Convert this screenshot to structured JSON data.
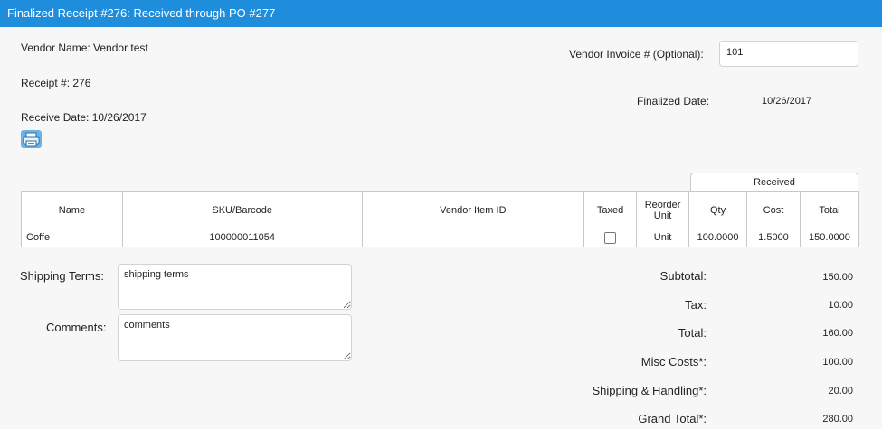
{
  "window": {
    "title": "Finalized Receipt #276: Received through PO #277"
  },
  "info": {
    "vendor_name": "Vendor Name: Vendor test",
    "receipt_no": "Receipt #: 276",
    "receive_date": "Receive Date: 10/26/2017",
    "vendor_invoice_label": "Vendor Invoice # (Optional):",
    "vendor_invoice_value": "101",
    "finalized_date_label": "Finalized Date:",
    "finalized_date_value": "10/26/2017"
  },
  "table": {
    "group_header": "Received",
    "headers": [
      "Name",
      "SKU/Barcode",
      "Vendor Item ID",
      "Taxed",
      "Reorder Unit",
      "Qty",
      "Cost",
      "Total"
    ],
    "rows": [
      {
        "name": "Coffe",
        "sku": "100000011054",
        "vendor_item_id": "",
        "taxed": false,
        "reorder_unit": "Unit",
        "qty": "100.0000",
        "cost": "1.5000",
        "total": "150.0000"
      }
    ]
  },
  "notes": {
    "shipping_terms_label": "Shipping Terms:",
    "shipping_terms_value": "shipping terms",
    "comments_label": "Comments:",
    "comments_value": "comments"
  },
  "summary": {
    "subtotal_label": "Subtotal:",
    "subtotal": "150.00",
    "tax_label": "Tax:",
    "tax": "10.00",
    "total_label": "Total:",
    "total": "160.00",
    "misc_label": "Misc Costs*:",
    "misc": "100.00",
    "shipping_label": "Shipping & Handling*:",
    "shipping": "20.00",
    "grand_label": "Grand Total*:",
    "grand": "280.00"
  },
  "icons": {
    "print": "printer-icon"
  },
  "colors": {
    "title_bar": "#1e8ddb",
    "print_button": "#6bb3e6"
  }
}
